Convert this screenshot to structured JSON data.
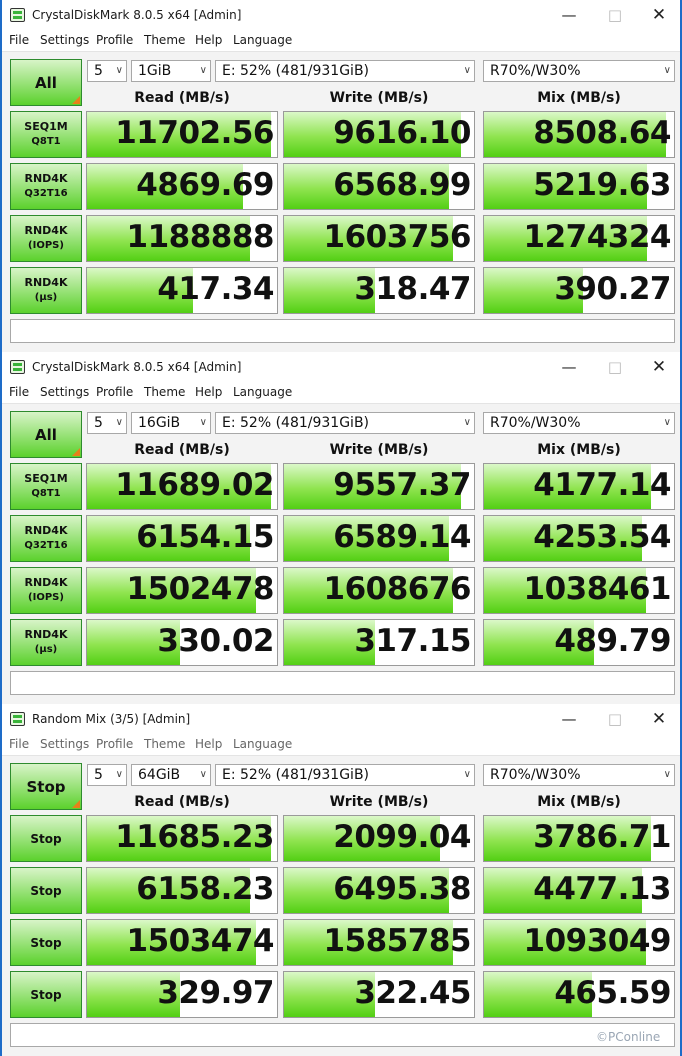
{
  "menu": [
    "File",
    "Settings",
    "Profile",
    "Theme",
    "Help",
    "Language"
  ],
  "columns": [
    "Read (MB/s)",
    "Write (MB/s)",
    "Mix (MB/s)"
  ],
  "row_labels": [
    {
      "l1": "SEQ1M",
      "l2": "Q8T1"
    },
    {
      "l1": "RND4K",
      "l2": "Q32T16"
    },
    {
      "l1": "RND4K",
      "l2": "(IOPS)"
    },
    {
      "l1": "RND4K",
      "l2": "(µs)"
    }
  ],
  "windows": [
    {
      "title": "CrystalDiskMark 8.0.5 x64 [Admin]",
      "main_button": "All",
      "count": "5",
      "size": "1GiB",
      "drive": "E: 52% (481/931GiB)",
      "mix": "R70%/W30%",
      "rows": [
        {
          "label": [
            "SEQ1M",
            "Q8T1"
          ],
          "values": [
            "11702.56",
            "9616.10",
            "8508.64"
          ],
          "levels": [
            0.97,
            0.93,
            0.96
          ]
        },
        {
          "label": [
            "RND4K",
            "Q32T16"
          ],
          "values": [
            "4869.69",
            "6568.99",
            "5219.63"
          ],
          "levels": [
            0.82,
            0.87,
            0.86
          ]
        },
        {
          "label": [
            "RND4K",
            "(IOPS)"
          ],
          "values": [
            "1188888",
            "1603756",
            "1274324"
          ],
          "levels": [
            0.86,
            0.89,
            0.86
          ]
        },
        {
          "label": [
            "RND4K",
            "(µs)"
          ],
          "values": [
            "417.34",
            "318.47",
            "390.27"
          ],
          "levels": [
            0.56,
            0.48,
            0.52
          ]
        }
      ]
    },
    {
      "title": "CrystalDiskMark 8.0.5 x64 [Admin]",
      "main_button": "All",
      "count": "5",
      "size": "16GiB",
      "drive": "E: 52% (481/931GiB)",
      "mix": "R70%/W30%",
      "rows": [
        {
          "label": [
            "SEQ1M",
            "Q8T1"
          ],
          "values": [
            "11689.02",
            "9557.37",
            "4177.14"
          ],
          "levels": [
            0.97,
            0.93,
            0.88
          ]
        },
        {
          "label": [
            "RND4K",
            "Q32T16"
          ],
          "values": [
            "6154.15",
            "6589.14",
            "4253.54"
          ],
          "levels": [
            0.86,
            0.87,
            0.83
          ]
        },
        {
          "label": [
            "RND4K",
            "(IOPS)"
          ],
          "values": [
            "1502478",
            "1608676",
            "1038461"
          ],
          "levels": [
            0.89,
            0.89,
            0.85
          ]
        },
        {
          "label": [
            "RND4K",
            "(µs)"
          ],
          "values": [
            "330.02",
            "317.15",
            "489.79"
          ],
          "levels": [
            0.49,
            0.48,
            0.58
          ]
        }
      ]
    },
    {
      "title": "Random Mix (3/5) [Admin]",
      "main_button": "Stop",
      "count": "5",
      "size": "64GiB",
      "drive": "E: 52% (481/931GiB)",
      "mix": "R70%/W30%",
      "rows": [
        {
          "label": [
            "Stop"
          ],
          "values": [
            "11685.23",
            "2099.04",
            "3786.71"
          ],
          "levels": [
            0.97,
            0.82,
            0.88
          ]
        },
        {
          "label": [
            "Stop"
          ],
          "values": [
            "6158.23",
            "6495.38",
            "4477.13"
          ],
          "levels": [
            0.86,
            0.87,
            0.83
          ]
        },
        {
          "label": [
            "Stop"
          ],
          "values": [
            "1503474",
            "1585785",
            "1093049"
          ],
          "levels": [
            0.89,
            0.89,
            0.85
          ]
        },
        {
          "label": [
            "Stop"
          ],
          "values": [
            "329.97",
            "322.45",
            "465.59"
          ],
          "levels": [
            0.49,
            0.48,
            0.57
          ]
        }
      ]
    }
  ],
  "watermark": "©PConline",
  "colors": {
    "bar_green": "#52cf14",
    "button_green": "#5bd12c",
    "frame_blue": "#1e6cc8"
  }
}
